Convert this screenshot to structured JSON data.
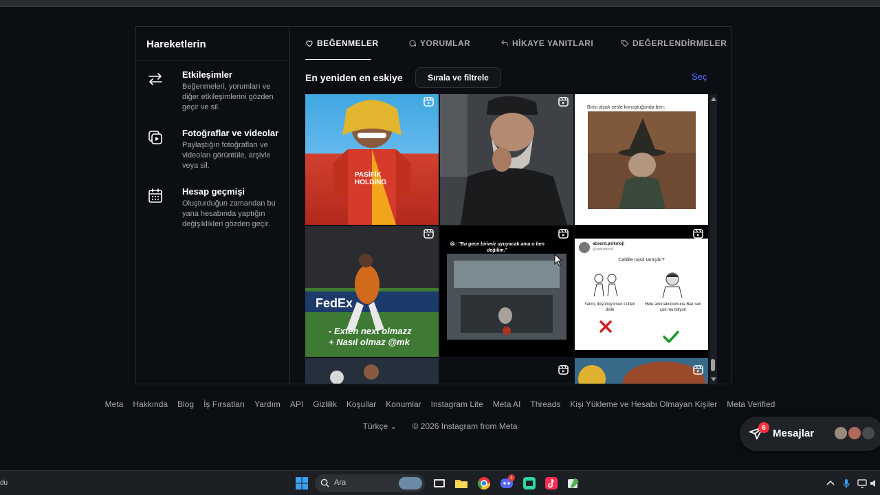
{
  "sidebar": {
    "title": "Hareketlerin",
    "items": [
      {
        "label": "Etkileşimler",
        "desc": "Beğenmeleri, yorumları ve diğer etkileşimlerini gözden geçir ve sil."
      },
      {
        "label": "Fotoğraflar ve videolar",
        "desc": "Paylaştığın fotoğrafları ve videoları görüntüle, arşivle veya sil."
      },
      {
        "label": "Hesap geçmişi",
        "desc": "Oluşturduğun zamandan bu yana hesabında yaptığın değişiklikleri gözden geçir."
      }
    ]
  },
  "tabs": [
    {
      "label": "BEĞENMELER",
      "icon": "heart-icon",
      "active": true
    },
    {
      "label": "YORUMLAR",
      "icon": "comment-icon",
      "active": false
    },
    {
      "label": "HİKAYE YANITLARI",
      "icon": "reply-icon",
      "active": false
    },
    {
      "label": "DEĞERLENDİRMELER",
      "icon": "tag-icon",
      "active": false
    }
  ],
  "toolbar": {
    "sort_label": "En yeniden en eskiye",
    "filter_button": "Sırala ve filtrele",
    "select_link": "Seç"
  },
  "grid": {
    "tiles": [
      {
        "caption": "PASİFİK HOLDİNG",
        "reel": true
      },
      {
        "caption": "",
        "reel": true
      },
      {
        "caption": "Birisi alçak sesle konuştuğunda ben:",
        "reel": false
      },
      {
        "caption_lines": [
          "- Exten next olmazz",
          "+ Nasıl olmaz @mk"
        ],
        "reel": true
      },
      {
        "caption": "😂: \"Bu gece birimiz uyuyacak ama o ben değilim.\"",
        "reel": true
      },
      {
        "handle": "absurd.psikoloji",
        "subhandle": "@zaftumlecili",
        "question": "Cahille nasıl tartışılır?",
        "left_caption": "Yanlış düşünüyorsun Lütfen dinle",
        "right_caption": "Hele amınakodumuna Bak sen çok mu biliyon",
        "reel": true
      },
      {
        "caption": "",
        "reel": false
      },
      {
        "caption": "",
        "reel": true
      },
      {
        "caption": "",
        "reel": true
      }
    ]
  },
  "footer": {
    "links": [
      "Meta",
      "Hakkında",
      "Blog",
      "İş Fırsatları",
      "Yardım",
      "API",
      "Gizlilik",
      "Koşullar",
      "Konumlar",
      "Instagram Lite",
      "Meta AI",
      "Threads",
      "Kişi Yükleme ve Hesabı Olmayan Kişiler",
      "Meta Verified"
    ],
    "language": "Türkçe",
    "copyright": "© 2026 Instagram from Meta"
  },
  "messages": {
    "label": "Mesajlar",
    "badge": "6"
  },
  "taskbar": {
    "left_text": "du",
    "search_placeholder": "Ara",
    "discord_badge": "1"
  },
  "colors": {
    "background": "#0b0f14",
    "accent": "#5b6cff",
    "badge": "#ff3040"
  }
}
